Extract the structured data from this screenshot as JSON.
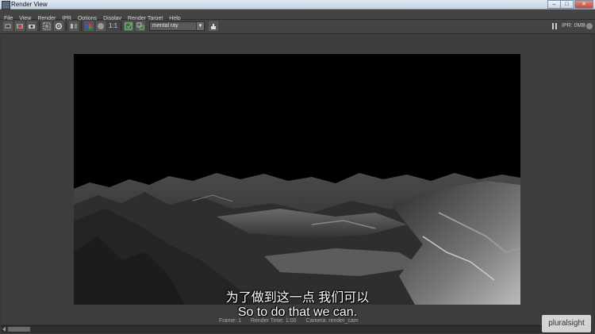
{
  "window": {
    "title": "Render View"
  },
  "menu": {
    "items": [
      "File",
      "View",
      "Render",
      "IPR",
      "Options",
      "Display",
      "Render Target",
      "Help"
    ]
  },
  "toolbar": {
    "ratio_label": "1:1",
    "renderer": "mental ray",
    "renderer_caret": "▼",
    "ipr_status": "IPR: 0MB",
    "icons": [
      "redo-render-icon",
      "ipr-render-icon",
      "snapshot-icon",
      "refresh-icon",
      "render-region-icon",
      "color-channel-icon",
      "alpha-channel-icon",
      "keep-image-icon",
      "remove-image-icon",
      "render-settings-icon",
      "pause-icon"
    ]
  },
  "render_info": {
    "frame": "Frame: 1",
    "render_time": "Render Time: 1:00",
    "camera": "Camera: render_cam"
  },
  "subtitles": {
    "zh": "为了做到这一点 我们可以",
    "en": "So to do that we can."
  },
  "watermark": {
    "text": "pluralsight"
  },
  "colors": {
    "background": "#3a3a3a",
    "panel": "#444444",
    "render_bg": "#000000"
  }
}
